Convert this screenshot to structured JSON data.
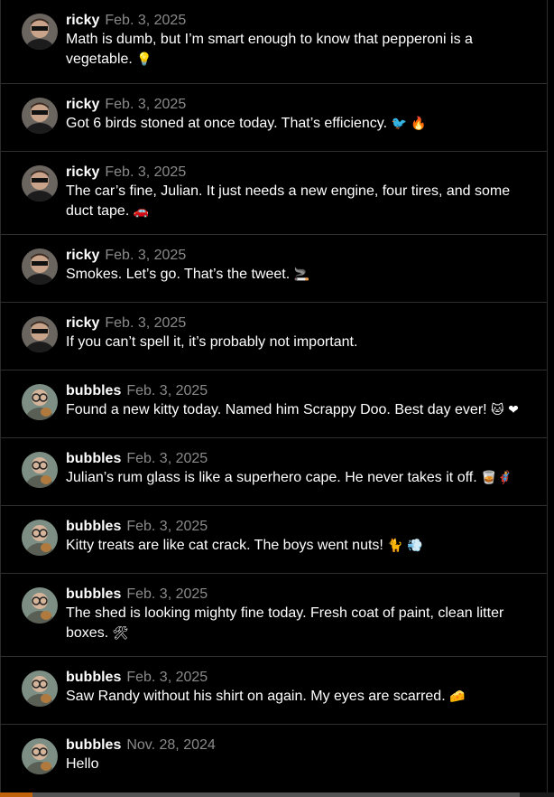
{
  "posts": [
    {
      "user": "ricky",
      "date": "Feb. 3, 2025",
      "text": "Math is dumb, but I’m smart enough to know that pepperoni is a vegetable.",
      "emoji": "💡"
    },
    {
      "user": "ricky",
      "date": "Feb. 3, 2025",
      "text": "Got 6 birds stoned at once today. That’s efficiency.",
      "emoji": "🐦 🔥"
    },
    {
      "user": "ricky",
      "date": "Feb. 3, 2025",
      "text": "The car’s fine, Julian. It just needs a new engine, four tires, and some duct tape.",
      "emoji": "🚗"
    },
    {
      "user": "ricky",
      "date": "Feb. 3, 2025",
      "text": "Smokes. Let’s go. That’s the tweet.",
      "emoji": "🚬"
    },
    {
      "user": "ricky",
      "date": "Feb. 3, 2025",
      "text": "If you can’t spell it, it’s probably not important.",
      "emoji": ""
    },
    {
      "user": "bubbles",
      "date": "Feb. 3, 2025",
      "text": "Found a new kitty today. Named him Scrappy Doo. Best day ever!",
      "emoji": "🐱 ❤"
    },
    {
      "user": "bubbles",
      "date": "Feb. 3, 2025",
      "text": "Julian’s rum glass is like a superhero cape. He never takes it off.",
      "emoji": "🥃🦸"
    },
    {
      "user": "bubbles",
      "date": "Feb. 3, 2025",
      "text": "Kitty treats are like cat crack. The boys went nuts!",
      "emoji": "🐈 💨"
    },
    {
      "user": "bubbles",
      "date": "Feb. 3, 2025",
      "text": "The shed is looking mighty fine today. Fresh coat of paint, clean litter boxes.",
      "emoji": "🛠"
    },
    {
      "user": "bubbles",
      "date": "Feb. 3, 2025",
      "text": "Saw Randy without his shirt on again. My eyes are scarred.",
      "emoji": "🧀"
    },
    {
      "user": "bubbles",
      "date": "Nov. 28, 2024",
      "text": "Hello",
      "emoji": ""
    }
  ]
}
